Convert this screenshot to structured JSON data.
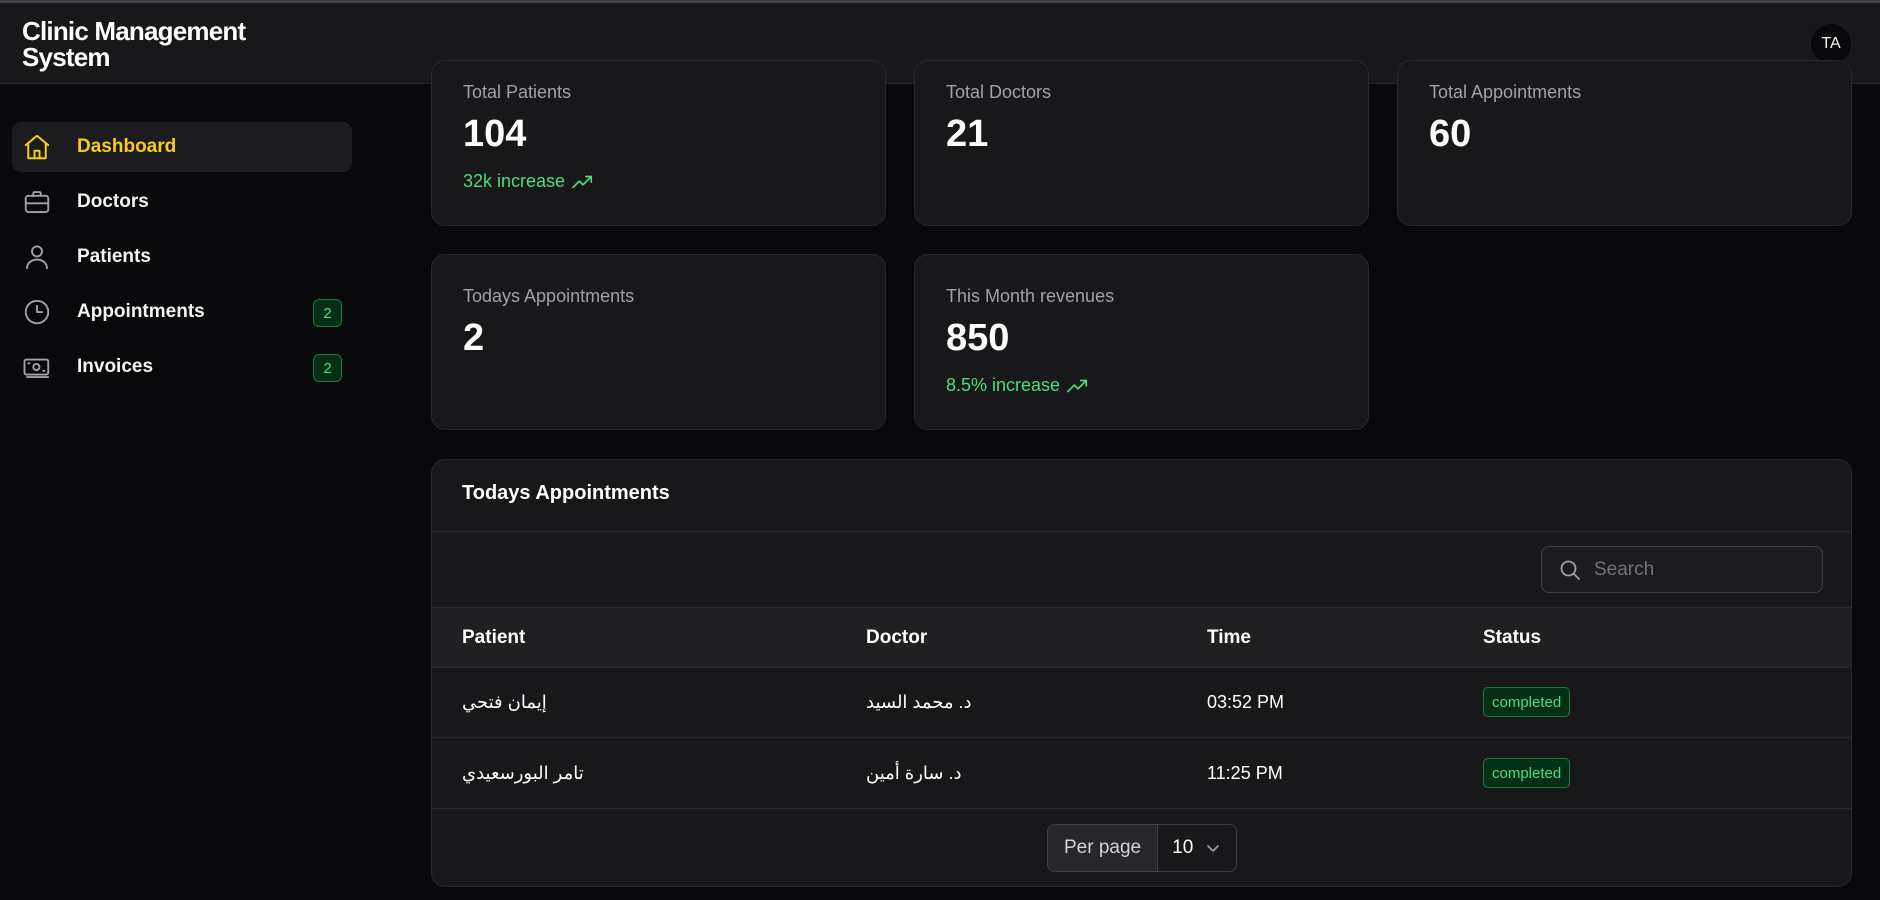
{
  "app": {
    "title": "Clinic Management System"
  },
  "user": {
    "initials": "TA"
  },
  "sidebar": {
    "items": [
      {
        "label": "Dashboard",
        "icon": "home-icon",
        "active": true
      },
      {
        "label": "Doctors",
        "icon": "briefcase-icon"
      },
      {
        "label": "Patients",
        "icon": "user-icon"
      },
      {
        "label": "Appointments",
        "icon": "clock-icon",
        "badge": "2"
      },
      {
        "label": "Invoices",
        "icon": "banknote-icon",
        "badge": "2"
      }
    ]
  },
  "stats": [
    {
      "label": "Total Patients",
      "value": "104",
      "trend": "32k increase"
    },
    {
      "label": "Total Doctors",
      "value": "21"
    },
    {
      "label": "Total Appointments",
      "value": "60"
    },
    {
      "label": "Todays Appointments",
      "value": "2"
    },
    {
      "label": "This Month revenues",
      "value": "850",
      "trend": "8.5% increase"
    }
  ],
  "appointments": {
    "title": "Todays Appointments",
    "search_placeholder": "Search",
    "columns": [
      "Patient",
      "Doctor",
      "Time",
      "Status"
    ],
    "rows": [
      {
        "patient": "إيمان فتحي",
        "doctor": "د. محمد السيد",
        "time": "03:52 PM",
        "status": "completed"
      },
      {
        "patient": "تامر البورسعيدي",
        "doctor": "د. سارة أمين",
        "time": "11:25 PM",
        "status": "completed"
      }
    ],
    "per_page_label": "Per page",
    "per_page_value": "10"
  },
  "colors": {
    "accent": "#facc15",
    "success": "#4ade80",
    "background": "#09090b",
    "card": "#18181b"
  }
}
